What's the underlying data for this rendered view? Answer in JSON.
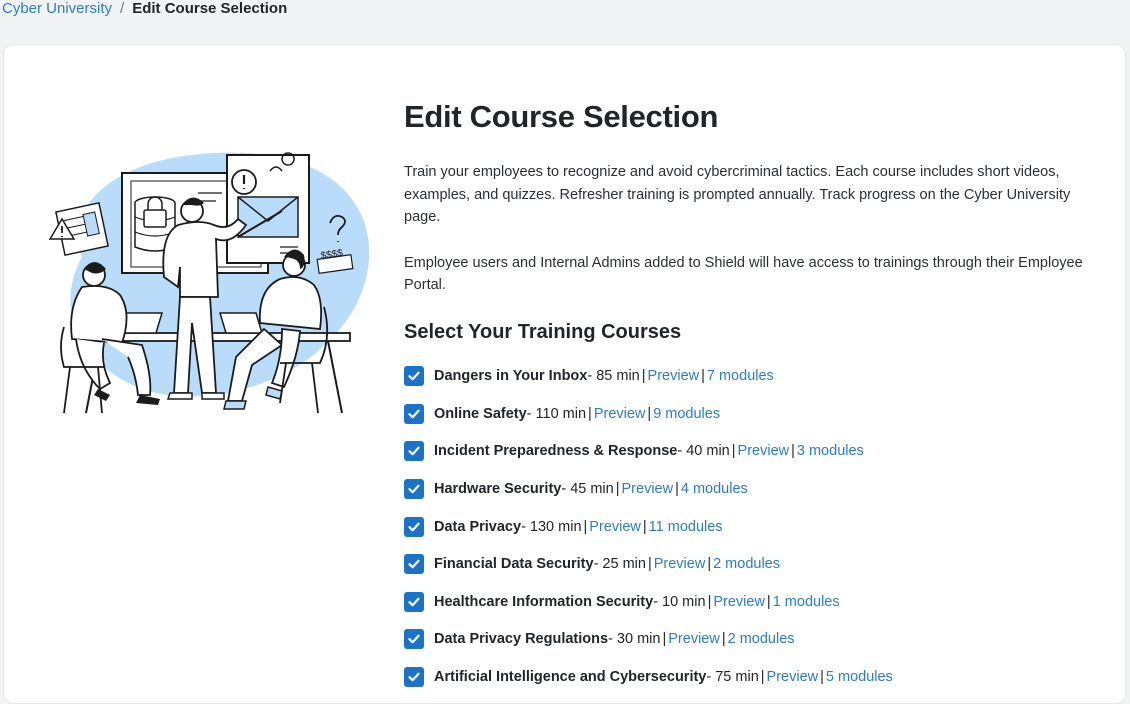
{
  "breadcrumb": {
    "parent": "Cyber University",
    "separator": "/",
    "current": "Edit Course Selection"
  },
  "page": {
    "title": "Edit Course Selection",
    "description_1": "Train your employees to recognize and avoid cybercriminal tactics. Each course includes short videos, examples, and quizzes. Refresher training is prompted annually. Track progress on the Cyber University page.",
    "description_2": "Employee users and Internal Admins added to Shield will have access to trainings through their Employee Portal.",
    "section_title": "Select Your Training Courses"
  },
  "illustration": {
    "icon": "team-training-illustration",
    "price_text": "$$$$"
  },
  "colors": {
    "accent": "#1a73c8",
    "link": "#2a7bd0",
    "illustration_blob": "#b9dcfb"
  },
  "courses": [
    {
      "name": "Dangers in Your Inbox",
      "duration": " - 85 min",
      "preview": "Preview",
      "modules": "7 modules",
      "checked": true
    },
    {
      "name": "Online Safety",
      "duration": " - 110 min",
      "preview": "Preview",
      "modules": "9 modules",
      "checked": true
    },
    {
      "name": "Incident Preparedness & Response",
      "duration": " - 40 min",
      "preview": "Preview",
      "modules": "3 modules",
      "checked": true
    },
    {
      "name": "Hardware Security",
      "duration": " - 45 min",
      "preview": "Preview",
      "modules": "4 modules",
      "checked": true
    },
    {
      "name": "Data Privacy",
      "duration": " - 130 min",
      "preview": "Preview",
      "modules": "11 modules",
      "checked": true
    },
    {
      "name": "Financial Data Security",
      "duration": " - 25 min",
      "preview": "Preview",
      "modules": "2 modules",
      "checked": true
    },
    {
      "name": "Healthcare Information Security",
      "duration": " - 10 min",
      "preview": "Preview",
      "modules": "1 modules",
      "checked": true
    },
    {
      "name": "Data Privacy Regulations",
      "duration": " - 30 min",
      "preview": "Preview",
      "modules": "2 modules",
      "checked": true
    },
    {
      "name": "Artificial Intelligence and Cybersecurity",
      "duration": " - 75 min",
      "preview": "Preview",
      "modules": "5 modules",
      "checked": true
    }
  ]
}
